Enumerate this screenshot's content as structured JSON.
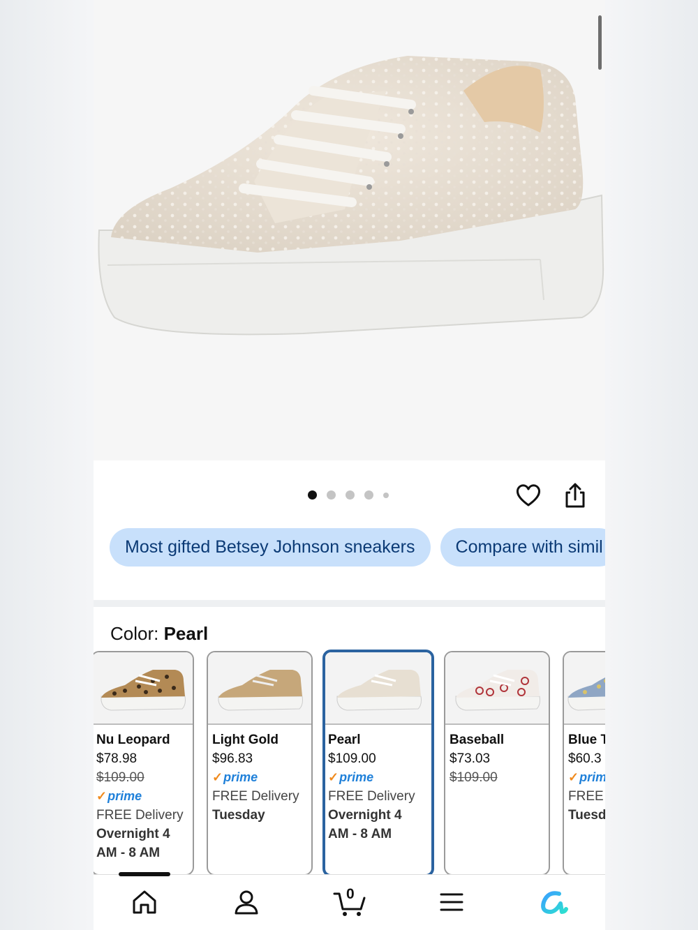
{
  "product": {
    "image_alt": "Pearl embellished platform sneaker",
    "carousel_dots": 5,
    "carousel_active": 0
  },
  "actions": {
    "favorite_icon": "heart-icon",
    "share_icon": "share-icon"
  },
  "chips": [
    "Most gifted Betsey Johnson sneakers",
    "Compare with simil"
  ],
  "color": {
    "label": "Color: ",
    "value": "Pearl"
  },
  "swatches": [
    {
      "name": "Nu Leopard",
      "price": "$78.98",
      "list_price": "$109.00",
      "prime": "prime",
      "delivery": "FREE Delivery",
      "delivery_time_1": "Overnight 4",
      "delivery_time_2": "AM - 8 AM"
    },
    {
      "name": "Light Gold",
      "price": "$96.83",
      "prime": "prime",
      "delivery": "FREE Delivery",
      "delivery_time_1": "Tuesday"
    },
    {
      "name": "Pearl",
      "price": "$109.00",
      "prime": "prime",
      "delivery": "FREE Delivery",
      "delivery_time_1": "Overnight 4",
      "delivery_time_2": "AM - 8 AM",
      "selected": true
    },
    {
      "name": "Baseball",
      "price": "$73.03",
      "list_price": "$109.00"
    },
    {
      "name": "Blue T",
      "price": "$60.3",
      "prime": "prim",
      "delivery": "FREE",
      "delivery_time_1": "Tuesd"
    }
  ],
  "nav": {
    "items": [
      "home-icon",
      "account-icon",
      "cart-icon",
      "menu-icon",
      "assistant-icon"
    ],
    "cart_count": "0",
    "active": "home"
  },
  "colors": {
    "chip_bg": "#c8e0fb",
    "chip_text": "#0b3a75",
    "selected_border": "#2b63a0",
    "prime_blue": "#1f80d9",
    "prime_check": "#f08a1d"
  }
}
